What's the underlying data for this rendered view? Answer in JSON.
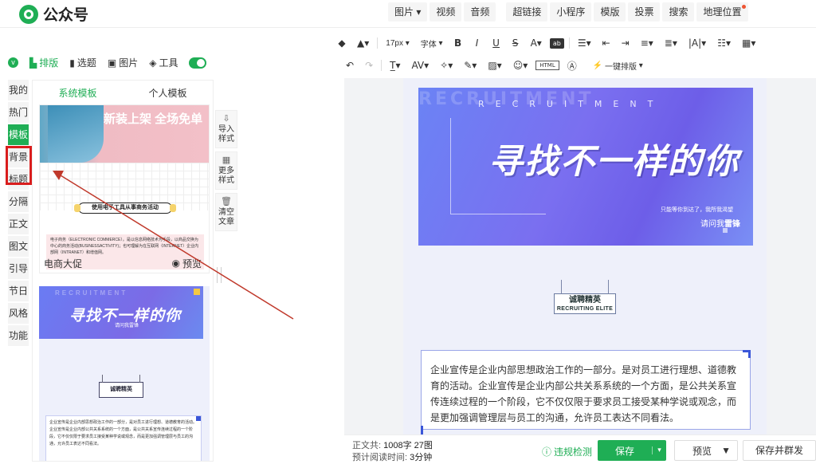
{
  "app": {
    "name": "公众号",
    "logo_icon": "wechat-official-icon"
  },
  "top_nav": [
    {
      "label": "图片",
      "dropdown": true
    },
    {
      "label": "视频"
    },
    {
      "label": "音频"
    },
    {
      "label": "超链接"
    },
    {
      "label": "小程序"
    },
    {
      "label": "模版"
    },
    {
      "label": "投票"
    },
    {
      "label": "搜索"
    },
    {
      "label": "地理位置"
    }
  ],
  "toolbar": {
    "font_size": "17px",
    "font_family": "字体",
    "row2_button": "一键排版"
  },
  "sub_tabs": [
    {
      "label": "排版",
      "icon": "layout-icon",
      "active": true
    },
    {
      "label": "选题",
      "icon": "bookmark-icon"
    },
    {
      "label": "图片",
      "icon": "image-icon"
    },
    {
      "label": "工具",
      "icon": "cube-icon"
    }
  ],
  "sidebar": [
    {
      "label": "我的"
    },
    {
      "label": "热门"
    },
    {
      "label": "模板",
      "active": true
    },
    {
      "label": "背景"
    },
    {
      "label": "标题"
    },
    {
      "label": "分隔"
    },
    {
      "label": "正文"
    },
    {
      "label": "图文"
    },
    {
      "label": "引导"
    },
    {
      "label": "节日"
    },
    {
      "label": "风格"
    },
    {
      "label": "功能"
    }
  ],
  "panel": {
    "tabs": [
      {
        "label": "系统模板",
        "active": true
      },
      {
        "label": "个人模板"
      }
    ],
    "card1": {
      "banner_title": "新装上架 全场免单",
      "ribbon": "使用电子工具从事商务活动",
      "body": "电子商务（ELECTRONIC COMMERCE）。是以信息网络技术为手段，以商品交换为中心的商务活动(BUSINESSACTIVITY)；也可理解为在互联网（INTERNET）企业内部网（INTRANET）和增值网。",
      "name": "电商大促",
      "preview": "预览"
    },
    "card2": {
      "title": "寻找不一样的你",
      "tagline": "只能等你到达了，我所我渴望",
      "waiting": "请问我雷锋",
      "tag": "诚聘精英",
      "body": "企业宣传是企业内部思想政治工作的一部分，是对员工进行理想、道德教育的活动。企业宣传是企业内部公共关系系统的一个方面，是公共关系宣传连续过程的一个阶段，它不仅仅限于要求员工接受某种学说或观念，而是更加强调管理层与员工的沟通，允许员工表达不同看法。"
    }
  },
  "float_tools": [
    {
      "label": "导入样式",
      "icon": "import-icon"
    },
    {
      "label": "更多样式",
      "icon": "grid-icon"
    },
    {
      "label": "清空文章",
      "icon": "trash-icon"
    }
  ],
  "document": {
    "hero_watermark": "RECRUITMENT",
    "hero_spaced": "RECRUITMENT",
    "hero_title": "寻找不一样的你",
    "hero_tagline": "只能等你到达了，我所我渴望",
    "hero_waiting_prefix": "请问我",
    "hero_waiting_bold": "雷锋",
    "elite_cn": "诚聘精英",
    "elite_en": "RECRUITING ELITE",
    "paragraph": "企业宣传是企业内部思想政治工作的一部分。是对员工进行理想、道德教育的活动。企业宣传是企业内部公共关系系统的一个方面，是公共关系宣传连续过程的一个阶段，它不仅仅限于要求员工接受某种学说或观念，而是更加强调管理层与员工的沟通，允许员工表达不同看法。"
  },
  "status": {
    "word_count_label": "正文共:",
    "word_count": "1008字 27图",
    "read_time_label": "预计阅读时间:",
    "read_time": "3分钟",
    "check_label": "违规检测",
    "save_label": "保存",
    "preview_label": "预览",
    "publish_label": "保存并群发"
  },
  "colors": {
    "brand_green": "#1fae55",
    "highlight_red": "#d91d1d",
    "hero_blue": "#6b83f5"
  }
}
